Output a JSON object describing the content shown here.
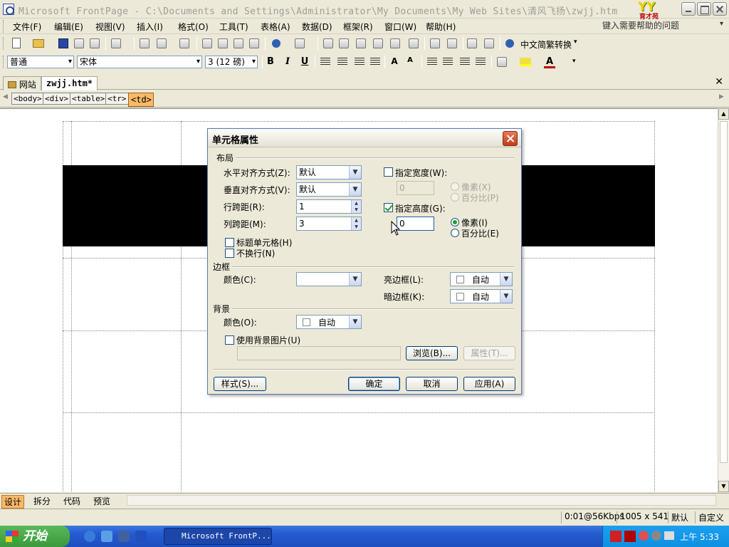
{
  "window": {
    "title": "Microsoft FrontPage - C:\\Documents and Settings\\Administrator\\My Documents\\My Web Sites\\清风飞扬\\zwjj.htm",
    "logo_text": "YY",
    "logo_sub": "育才苑"
  },
  "menubar": {
    "items": [
      "文件(F)",
      "编辑(E)",
      "视图(V)",
      "插入(I)",
      "格式(O)",
      "工具(T)",
      "表格(A)",
      "数据(D)",
      "框架(R)",
      "窗口(W)",
      "帮助(H)"
    ],
    "help_placeholder": "键入需要帮助的问题"
  },
  "toolbar": {
    "convert_label": "中文简繁转换",
    "style_value": "普通",
    "font_value": "宋体",
    "size_value": "3 (12 磅)",
    "bold": "B",
    "italic": "I",
    "underline": "U"
  },
  "doc_tabs": [
    {
      "label": "网站",
      "active": false
    },
    {
      "label": "zwjj.htm*",
      "active": true
    }
  ],
  "tag_path": [
    "<body>",
    "<div>",
    "<table>",
    "<tr>",
    "<td>"
  ],
  "view_tabs": [
    "设计",
    "拆分",
    "代码",
    "预览"
  ],
  "status": {
    "speed": "0:01@56Kbps",
    "resolution": "1005 x 541",
    "default": "默认",
    "custom": "自定义"
  },
  "taskbar": {
    "start": "开始",
    "task_label": "Microsoft FrontP...",
    "clock": "上午 5:33"
  },
  "dialog": {
    "title": "单元格属性",
    "layout_group": "布局",
    "h_align_label": "水平对齐方式(Z):",
    "h_align_value": "默认",
    "v_align_label": "垂直对齐方式(V):",
    "v_align_value": "默认",
    "rowspan_label": "行跨距(R):",
    "rowspan_value": "1",
    "colspan_label": "列跨距(M):",
    "colspan_value": "3",
    "header_cell_label": "标题单元格(H)",
    "nowrap_label": "不换行(N)",
    "width_label": "指定宽度(W):",
    "width_value": "0",
    "width_pixels": "像素(X)",
    "width_percent": "百分比(P)",
    "height_label": "指定高度(G):",
    "height_value": "0",
    "height_pixels": "像素(I)",
    "height_percent": "百分比(E)",
    "borders_group": "边框",
    "border_color_label": "颜色(C):",
    "light_border_label": "亮边框(L):",
    "light_border_value": "自动",
    "dark_border_label": "暗边框(K):",
    "dark_border_value": "自动",
    "bg_group": "背景",
    "bg_color_label": "颜色(O):",
    "bg_color_value": "自动",
    "bg_image_label": "使用背景图片(U)",
    "browse_btn": "浏览(B)...",
    "props_btn": "属性(T)...",
    "style_btn": "样式(S)...",
    "ok_btn": "确定",
    "cancel_btn": "取消",
    "apply_btn": "应用(A)"
  }
}
